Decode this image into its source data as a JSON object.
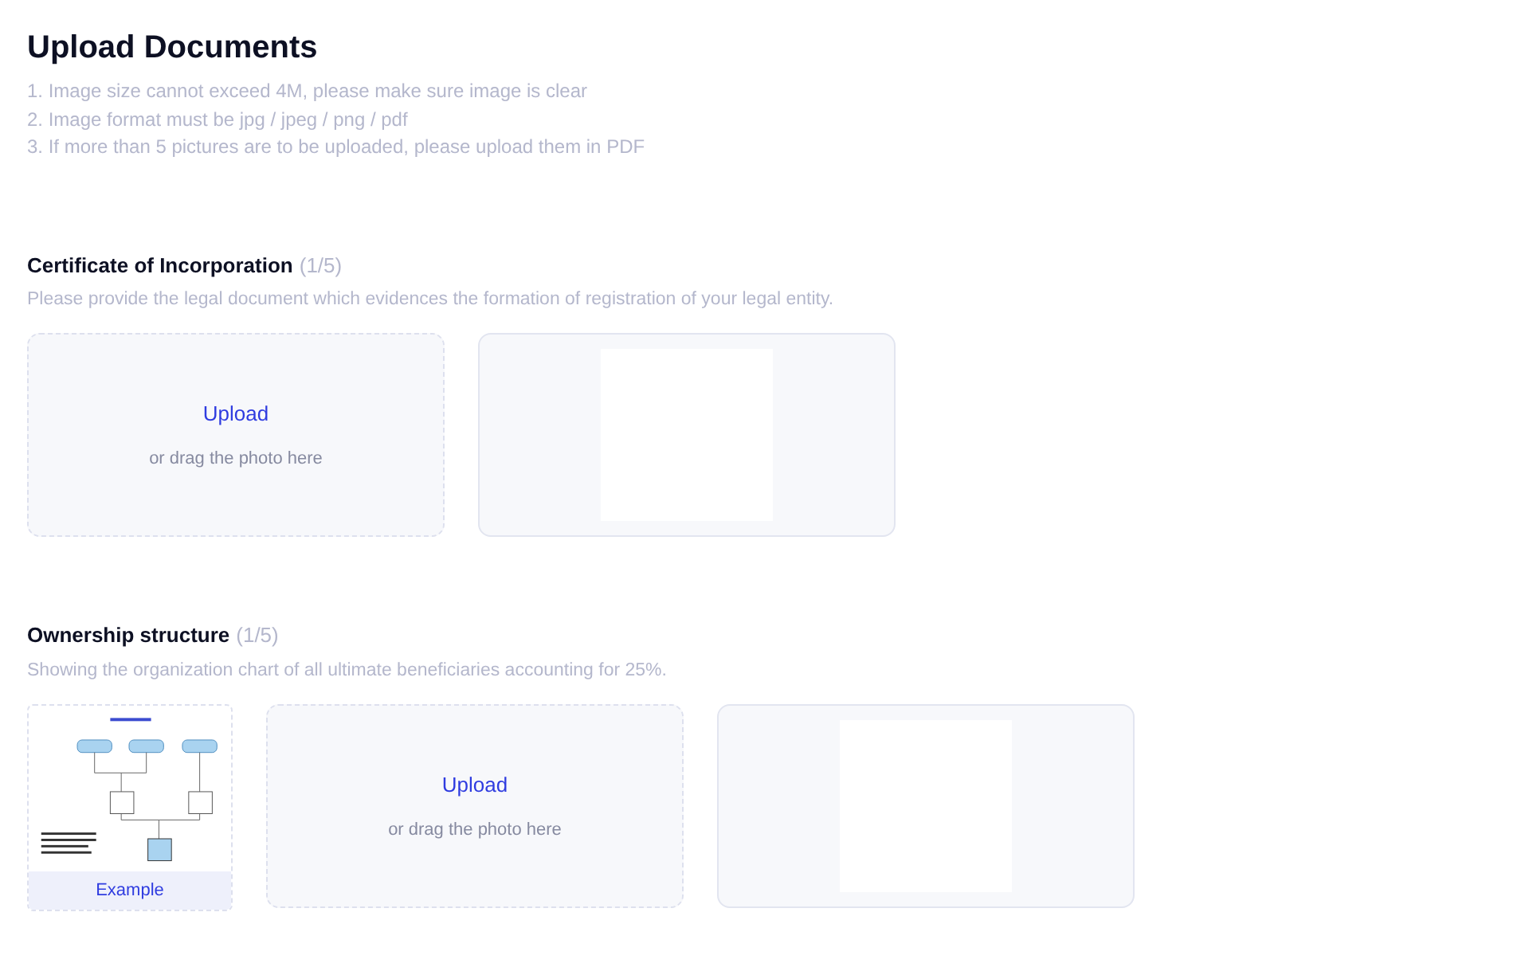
{
  "title": "Upload Documents",
  "notes": [
    "1. Image size cannot exceed 4M, please make sure image is clear",
    "2. Image format must be jpg / jpeg / png / pdf",
    "3. If more than 5 pictures are to be uploaded, please upload them in PDF"
  ],
  "sections": [
    {
      "title": "Certificate of Incorporation",
      "count": "(1/5)",
      "description": "Please provide the legal document which evidences the formation of registration of your legal entity.",
      "tiles": [
        {
          "kind": "upload",
          "action": "Upload",
          "hint": "or drag the photo here"
        },
        {
          "kind": "preview"
        }
      ]
    },
    {
      "title": "Ownership structure",
      "count": "(1/5)",
      "description": "Showing the organization chart of all ultimate beneficiaries accounting for 25%.",
      "tiles": [
        {
          "kind": "example",
          "label": "Example"
        },
        {
          "kind": "upload",
          "action": "Upload",
          "hint": "or drag the photo here"
        },
        {
          "kind": "preview"
        }
      ]
    }
  ]
}
